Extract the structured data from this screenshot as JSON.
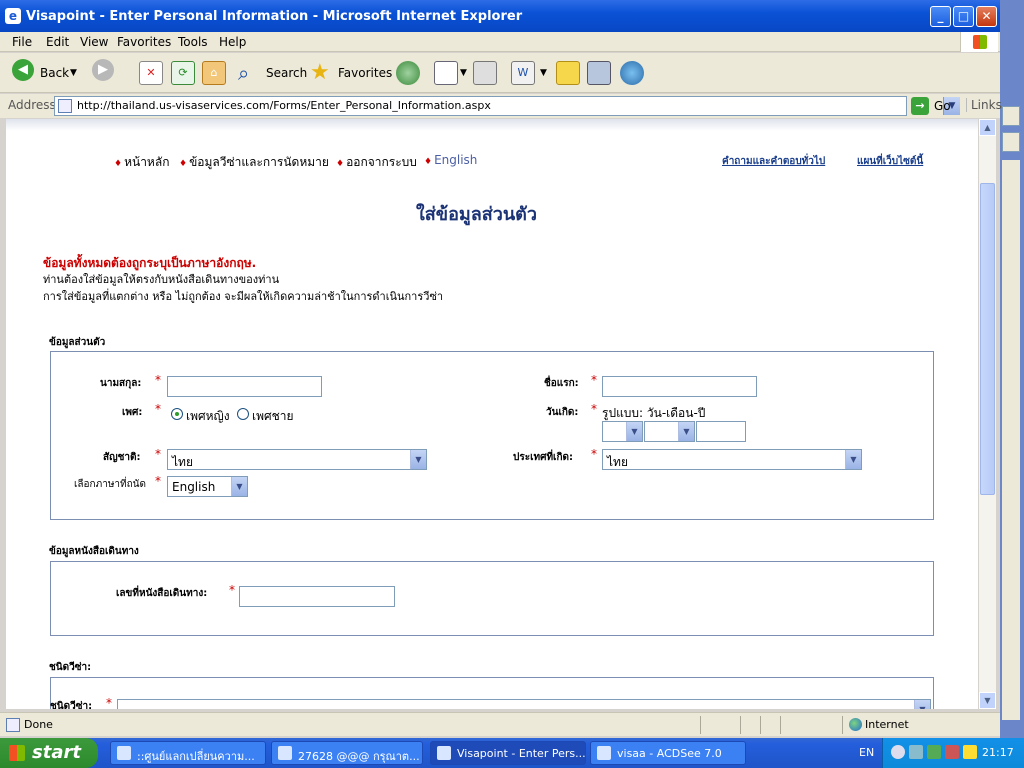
{
  "window": {
    "title": "Visapoint - Enter Personal Information - Microsoft Internet Explorer"
  },
  "menu": [
    "File",
    "Edit",
    "View",
    "Favorites",
    "Tools",
    "Help"
  ],
  "toolbar": {
    "back": "Back",
    "search": "Search",
    "favorites": "Favorites"
  },
  "address": {
    "label": "Address",
    "url": "http://thailand.us-visaservices.com/Forms/Enter_Personal_Information.aspx",
    "go": "Go",
    "links": "Links"
  },
  "nav": {
    "items": [
      "หน้าหลัก",
      "ข้อมูลวีซ่าและการนัดหมาย",
      "ออกจากระบบ",
      "English"
    ],
    "faq": "คำถามและคำตอบทั่วไป",
    "sitemap": "แผนที่เว็บไซต์นี้"
  },
  "page": {
    "title": "ใส่ข้อมูลส่วนตัว",
    "warning": "ข้อมูลทั้งหมดต้องถูกระบุเป็นภาษาอังกฤษ.",
    "info1": "ท่านต้องใส่ข้อมูลให้ตรงกับหนังสือเดินทางของท่าน",
    "info2": "การใส่ข้อมูลที่แตกต่าง หรือ ไม่ถูกต้อง จะมีผลให้เกิดความล่าช้าในการดำเนินการวีซ่า"
  },
  "personal": {
    "section": "ข้อมูลส่วนตัว",
    "surname_label": "นามสกุล:",
    "firstname_label": "ชื่อแรก:",
    "gender_label": "เพศ:",
    "female": "เพศหญิง",
    "male": "เพศชาย",
    "dob_label": "วันเกิด:",
    "dob_format": "รูปแบบ: วัน-เดือน-ปี",
    "nationality_label": "สัญชาติ:",
    "nationality_value": "ไทย",
    "birth_country_label": "ประเทศที่เกิด:",
    "birth_country_value": "ไทย",
    "language_label": "เลือกภาษาที่ถนัด",
    "language_value": "English"
  },
  "passport": {
    "section": "ข้อมูลหนังสือเดินทาง",
    "number_label": "เลขที่หนังสือเดินทาง:"
  },
  "visa": {
    "section": "ชนิดวีซ่า:",
    "type_label": "ชนิดวีซ่า:"
  },
  "status": {
    "text": "Done",
    "zone": "Internet"
  },
  "taskbar": {
    "start": "start",
    "tasks": [
      "::ศูนย์แลกเปลี่ยนความ...",
      "27628 @@@ กรุณาต...",
      "Visapoint - Enter Pers...",
      "visaa - ACDSee 7.0"
    ],
    "lang": "EN",
    "clock": "21:17"
  }
}
